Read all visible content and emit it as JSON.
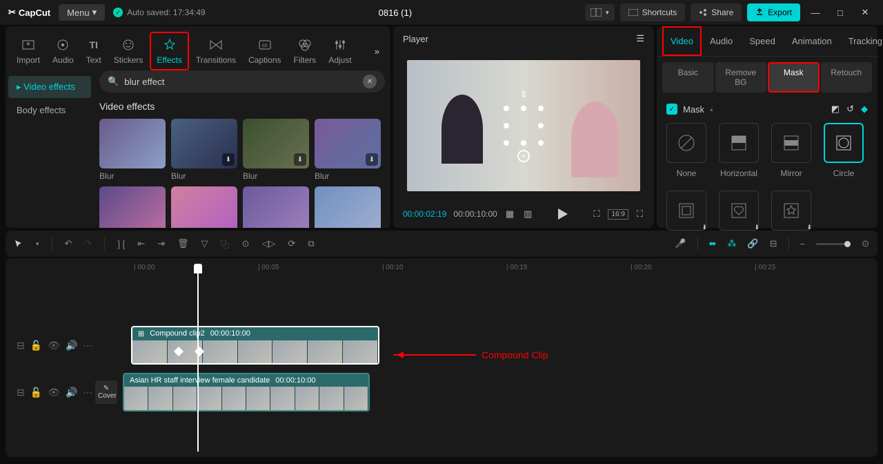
{
  "titlebar": {
    "logo": "CapCut",
    "menu": "Menu",
    "autosave": "Auto saved: 17:34:49",
    "project": "0816 (1)",
    "shortcuts": "Shortcuts",
    "share": "Share",
    "export": "Export"
  },
  "tool_tabs": [
    "Import",
    "Audio",
    "Text",
    "Stickers",
    "Effects",
    "Transitions",
    "Captions",
    "Filters",
    "Adjust"
  ],
  "effects_sidebar": [
    "Video effects",
    "Body effects"
  ],
  "search": {
    "value": "blur effect"
  },
  "effects_section_title": "Video effects",
  "effect_row1": [
    "Blur",
    "Blur",
    "Blur",
    "Blur"
  ],
  "player": {
    "title": "Player",
    "current": "00:00:02:19",
    "total": "00:00:10:00",
    "ratio": "16:9"
  },
  "prop_tabs": [
    "Video",
    "Audio",
    "Speed",
    "Animation",
    "Tracking"
  ],
  "sub_tabs": [
    "Basic",
    "Remove BG",
    "Mask",
    "Retouch"
  ],
  "mask_title": "Mask",
  "mask_items": [
    "None",
    "Horizontal",
    "Mirror",
    "Circle"
  ],
  "ruler": [
    "00:00",
    "00:05",
    "00:10",
    "00:15",
    "00:20",
    "00:25"
  ],
  "clip1": {
    "name": "Compound clip2",
    "dur": "00:00:10:00"
  },
  "clip2": {
    "name": "Asian HR staff interview female candidate",
    "dur": "00:00:10:00"
  },
  "cover": "Cover",
  "annotation": "Compound Clip"
}
